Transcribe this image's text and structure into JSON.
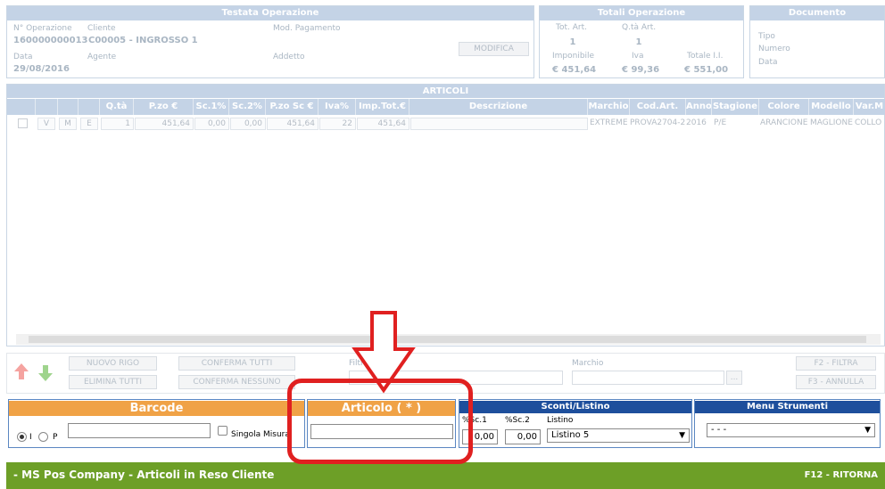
{
  "header": {
    "title": "Testata Operazione",
    "labels": {
      "operazione": "N° Operazione",
      "cliente": "Cliente",
      "pagamento": "Mod. Pagamento",
      "data": "Data",
      "agente": "Agente",
      "addetto": "Addetto"
    },
    "values": {
      "operazione": "160000000013",
      "cliente": "C00005 - INGROSSO 1",
      "data": "29/08/2016"
    },
    "modifica_label": "MODIFICA"
  },
  "totals": {
    "title": "Totali Operazione",
    "labels": {
      "tot_art": "Tot. Art.",
      "qta_art": "Q.tà Art.",
      "imponibile": "Imponibile",
      "iva": "Iva",
      "totale": "Totale I.I."
    },
    "values": {
      "tot_art": "1",
      "qta_art": "1",
      "imponibile": "€ 451,64",
      "iva": "€ 99,36",
      "totale": "€ 551,00"
    }
  },
  "document": {
    "title": "Documento",
    "labels": {
      "tipo": "Tipo",
      "numero": "Numero",
      "data": "Data"
    }
  },
  "articoli": {
    "title": "ARTICOLI",
    "columns": [
      "Q.tà",
      "P.zo €",
      "Sc.1%",
      "Sc.2%",
      "P.zo Sc €",
      "Iva%",
      "Imp.Tot.€",
      "Descrizione",
      "Marchio",
      "Cod.Art.",
      "Anno",
      "Stagione",
      "Colore",
      "Modello",
      "Var.M"
    ],
    "row": {
      "v": "V",
      "m": "M",
      "e": "E",
      "qta": "1",
      "prezzo": "451,64",
      "sc1": "0,00",
      "sc2": "0,00",
      "prezzo_sc": "451,64",
      "iva": "22",
      "imp_tot": "451,64",
      "descrizione": "",
      "marchio": "EXTREME",
      "cod_art": "PROVA2704-2",
      "anno": "2016",
      "stagione": "P/E",
      "colore": "ARANCIONE",
      "modello": "MAGLIONE",
      "var": "COLLO"
    }
  },
  "controls": {
    "nuovo_rigo": "NUOVO RIGO",
    "elimina_tutti": "ELIMINA TUTTI",
    "conferma_tutti": "CONFERMA TUTTI",
    "conferma_nessuno": "CONFERMA NESSUNO",
    "filtro_label": "Filtro",
    "marchio_label": "Marchio",
    "ellipsis": "...",
    "f2_filtra": "F2 - FILTRA",
    "f3_annulla": "F3 - ANNULLA"
  },
  "barcode": {
    "title": "Barcode",
    "radio_i": "I",
    "radio_p": "P",
    "singola_misura": "Singola Misura"
  },
  "articolo": {
    "title": "Articolo ( * )"
  },
  "sconti": {
    "title": "Sconti/Listino",
    "sc1_label": "%Sc.1",
    "sc2_label": "%Sc.2",
    "listino_label": "Listino",
    "sc1_value": "0,00",
    "sc2_value": "0,00",
    "listino_value": "Listino 5"
  },
  "menu": {
    "title": "Menu Strumenti",
    "value": "- - -"
  },
  "footer": {
    "title": "- MS Pos Company - Articoli in Reso Cliente",
    "ritorna": "F12 - RITORNA"
  },
  "colors": {
    "accent_green": "#6d9f27",
    "orange": "#f0a246",
    "blue": "#1e4f9c",
    "highlight_red": "#e02020"
  }
}
